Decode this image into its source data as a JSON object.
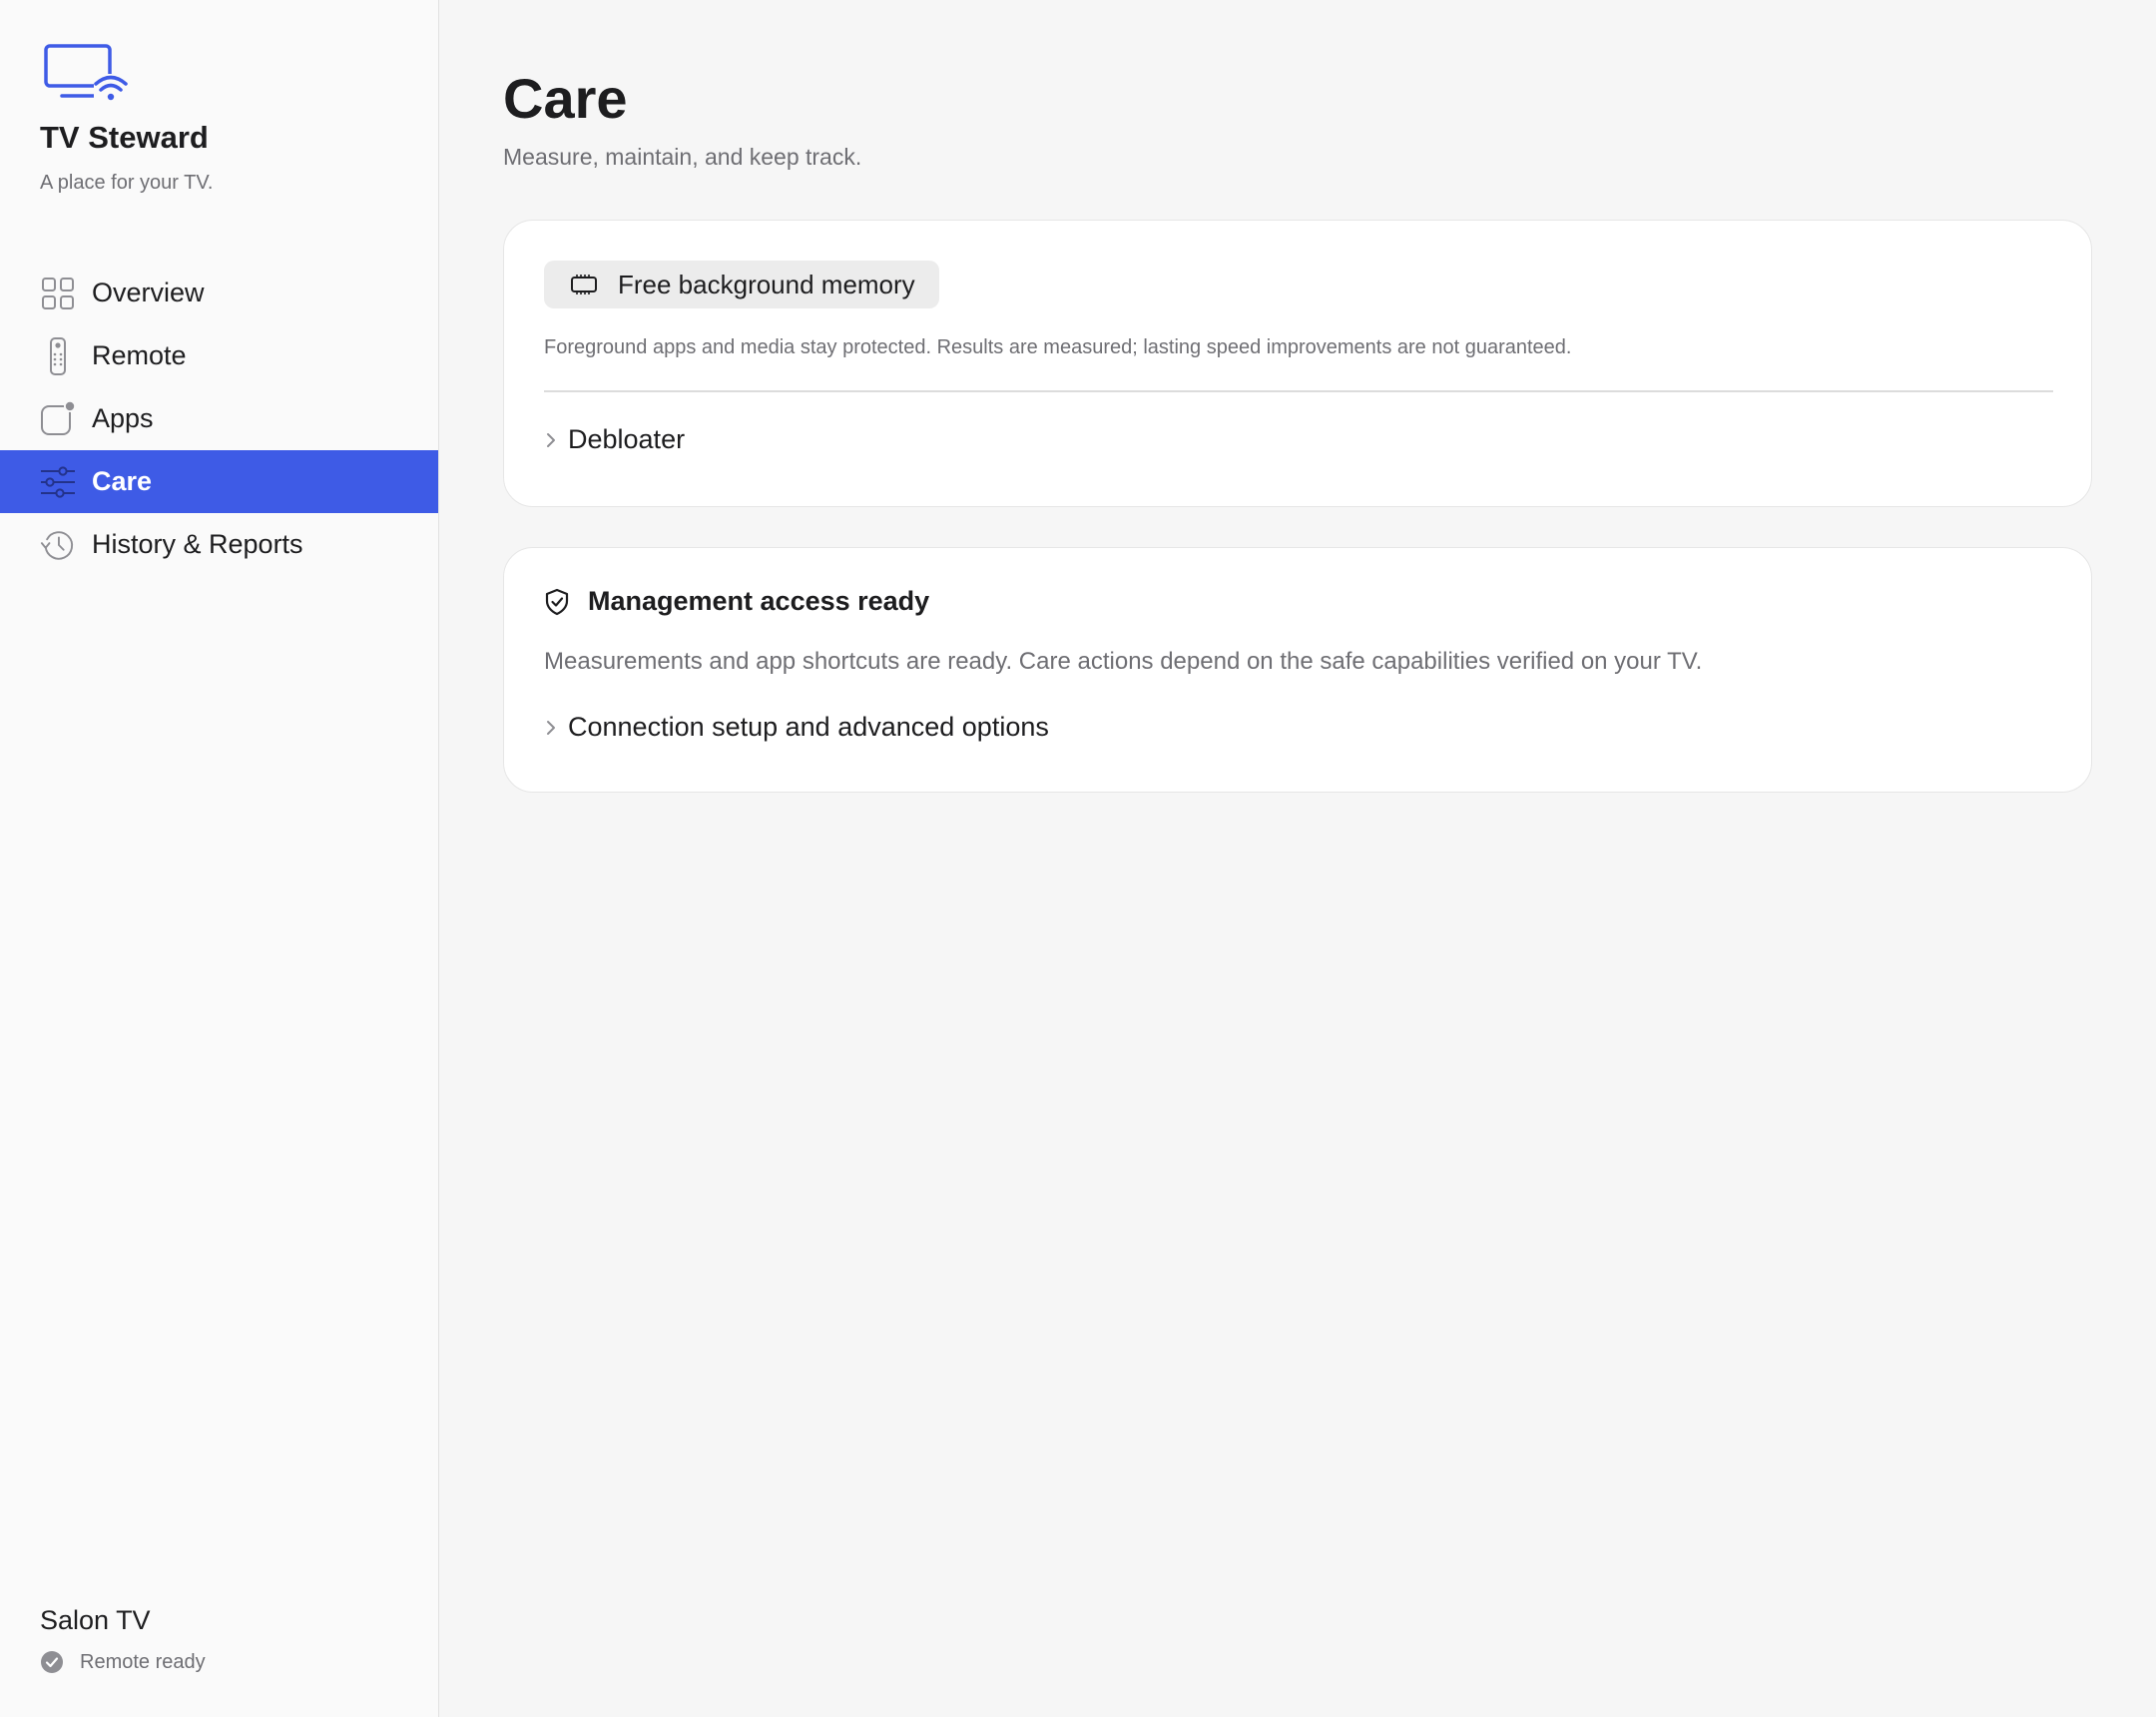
{
  "app": {
    "title": "TV Steward",
    "tagline": "A place for your TV.",
    "accent_color": "#3e5be6",
    "logo_icon": "tv-wifi-icon"
  },
  "sidebar": {
    "items": [
      {
        "label": "Overview",
        "icon": "grid-icon",
        "active": false
      },
      {
        "label": "Remote",
        "icon": "remote-icon",
        "active": false
      },
      {
        "label": "Apps",
        "icon": "app-badge-icon",
        "active": false
      },
      {
        "label": "Care",
        "icon": "sliders-icon",
        "active": true
      },
      {
        "label": "History & Reports",
        "icon": "history-icon",
        "active": false
      }
    ],
    "device": {
      "name": "Salon TV",
      "status": "Remote ready",
      "status_icon": "checkmark-circle-icon"
    }
  },
  "main": {
    "title": "Care",
    "subtitle": "Measure, maintain, and keep track.",
    "memory_card": {
      "action_label": "Free background memory",
      "action_icon": "memory-chip-icon",
      "note": "Foreground apps and media stay protected. Results are measured; lasting speed improvements are not guaranteed.",
      "disclosure_label": "Debloater"
    },
    "access_card": {
      "title": "Management access ready",
      "icon": "shield-check-icon",
      "text": "Measurements and app shortcuts are ready. Care actions depend on the safe capabilities verified on your TV.",
      "disclosure_label": "Connection setup and advanced options"
    }
  }
}
